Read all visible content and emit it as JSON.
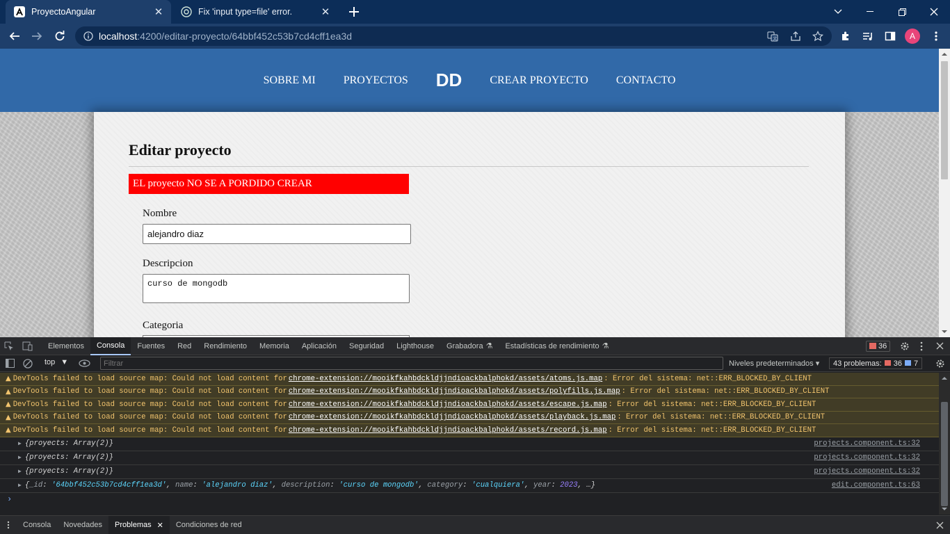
{
  "browser": {
    "tabs": [
      {
        "title": "ProyectoAngular",
        "active": true,
        "favicon": "angular-icon"
      },
      {
        "title": "Fix 'input type=file' error.",
        "active": false,
        "favicon": "chatgpt-icon"
      }
    ],
    "url_host": "localhost",
    "url_path": ":4200/editar-proyecto/64bbf452c53b7cd4cff1ea3d",
    "profile_initial": "A"
  },
  "site": {
    "nav": [
      "SOBRE MI",
      "PROYECTOS",
      "DD",
      "CREAR PROYECTO",
      "CONTACTO"
    ],
    "page_title": "Editar proyecto",
    "error_message": "EL proyecto NO SE A PORDIDO CREAR",
    "form": {
      "nombre_label": "Nombre",
      "nombre_value": "alejandro diaz",
      "descripcion_label": "Descripcion",
      "descripcion_value": "curso de mongodb",
      "categoria_label": "Categoria"
    }
  },
  "devtools": {
    "tabs": [
      "Elementos",
      "Consola",
      "Fuentes",
      "Red",
      "Rendimiento",
      "Memoria",
      "Aplicación",
      "Seguridad",
      "Lighthouse",
      "Grabadora",
      "Estadísticas de rendimiento"
    ],
    "active_tab": "Consola",
    "issues_badge": "36",
    "context": "top",
    "filter_placeholder": "Filtrar",
    "levels": "Niveles predeterminados",
    "problems_label": "43 problemas:",
    "problems_errors": "36",
    "problems_info": "7",
    "warnings": [
      {
        "pre": "DevTools failed to load source map: Could not load content for",
        "link": "chrome-extension://mooikfkahbdckldjjndioackbalphokd/assets/atoms.js.map",
        "post": ": Error del sistema: net::ERR_BLOCKED_BY_CLIENT"
      },
      {
        "pre": "DevTools failed to load source map: Could not load content for",
        "link": "chrome-extension://mooikfkahbdckldjjndioackbalphokd/assets/polyfills.js.map",
        "post": ": Error del sistema: net::ERR_BLOCKED_BY_CLIENT"
      },
      {
        "pre": "DevTools failed to load source map: Could not load content for",
        "link": "chrome-extension://mooikfkahbdckldjjndioackbalphokd/assets/escape.js.map",
        "post": ": Error del sistema: net::ERR_BLOCKED_BY_CLIENT"
      },
      {
        "pre": "DevTools failed to load source map: Could not load content for",
        "link": "chrome-extension://mooikfkahbdckldjjndioackbalphokd/assets/playback.js.map",
        "post": ": Error del sistema: net::ERR_BLOCKED_BY_CLIENT"
      },
      {
        "pre": "DevTools failed to load source map: Could not load content for",
        "link": "chrome-extension://mooikfkahbdckldjjndioackbalphokd/assets/record.js.map",
        "post": ": Error del sistema: net::ERR_BLOCKED_BY_CLIENT"
      }
    ],
    "logs": [
      {
        "text": "{proyects: Array(2)}",
        "source": "projects.component.ts:32"
      },
      {
        "text": "{proyects: Array(2)}",
        "source": "projects.component.ts:32"
      },
      {
        "text": "{proyects: Array(2)}",
        "source": "projects.component.ts:32"
      }
    ],
    "object_log": {
      "id": "'64bbf452c53b7cd4cff1ea3d'",
      "name": "'alejandro diaz'",
      "description": "'curso de mongodb'",
      "category": "'cualquiera'",
      "year": "2023",
      "source": "edit.component.ts:63"
    },
    "drawer_tabs": [
      "Consola",
      "Novedades",
      "Problemas",
      "Condiciones de red"
    ],
    "drawer_active": "Problemas"
  }
}
